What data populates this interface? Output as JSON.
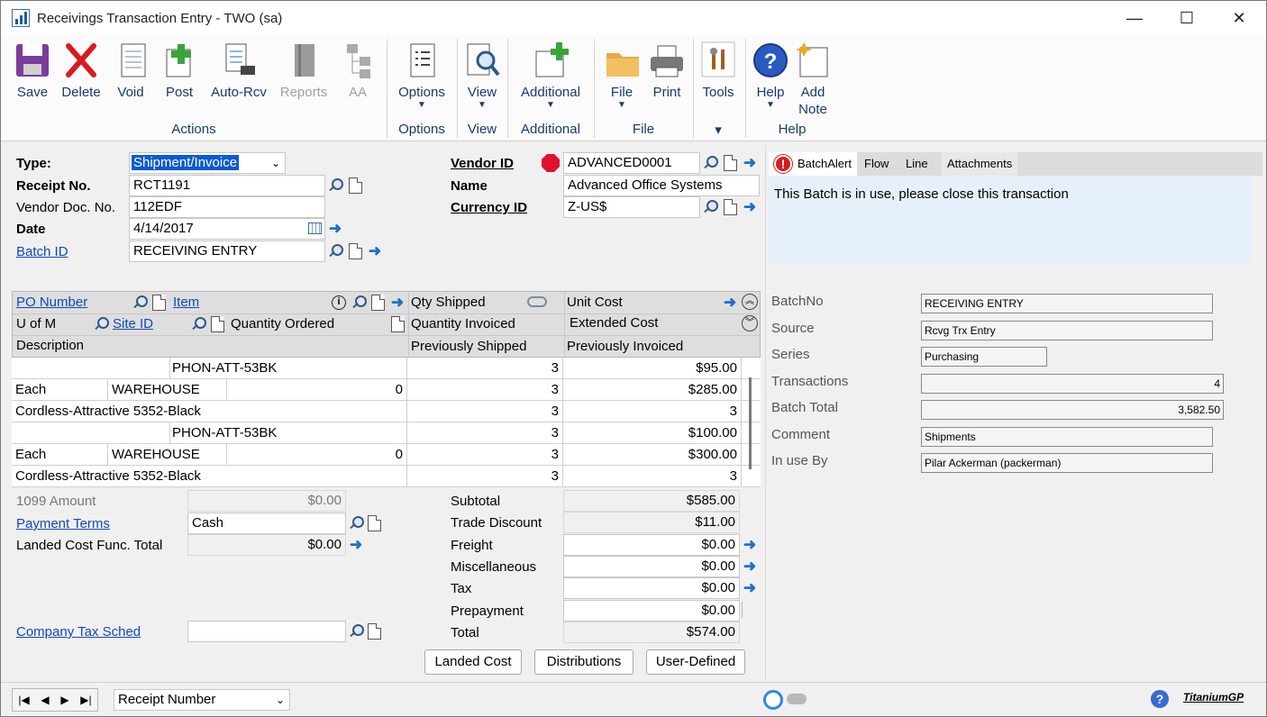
{
  "window": {
    "title": "Receivings Transaction Entry  -  TWO (sa)",
    "minimize": "—",
    "maximize": "☐",
    "close": "✕"
  },
  "ribbon": {
    "buttons": [
      {
        "label": "Save",
        "icon": "save-icon",
        "enabled": true
      },
      {
        "label": "Delete",
        "icon": "delete-icon",
        "enabled": true
      },
      {
        "label": "Void",
        "icon": "void-icon",
        "enabled": true
      },
      {
        "label": "Post",
        "icon": "post-icon",
        "enabled": true
      },
      {
        "label": "Auto-Rcv",
        "icon": "auto-receive-icon",
        "enabled": true
      },
      {
        "label": "Reports",
        "icon": "reports-icon",
        "enabled": false
      },
      {
        "label": "AA",
        "icon": "aa-icon",
        "enabled": false
      },
      {
        "label": "Options",
        "icon": "options-icon",
        "enabled": true
      },
      {
        "label": "View",
        "icon": "view-icon",
        "enabled": true
      },
      {
        "label": "Additional",
        "icon": "additional-icon",
        "enabled": true
      },
      {
        "label": "File",
        "icon": "file-icon",
        "enabled": true
      },
      {
        "label": "Print",
        "icon": "print-icon",
        "enabled": true
      },
      {
        "label": "Tools",
        "icon": "tools-icon",
        "enabled": true
      },
      {
        "label": "Help",
        "icon": "help-icon",
        "enabled": true
      },
      {
        "label": "Add",
        "label2": "Note",
        "icon": "add-note-icon",
        "enabled": true
      }
    ],
    "groups": [
      "Actions",
      "Options",
      "View",
      "Additional",
      "File",
      "Help"
    ],
    "tools_caret": "▾",
    "caret": "▼"
  },
  "header": {
    "type_label": "Type:",
    "type_value": "Shipment/Invoice",
    "receipt_label": "Receipt No.",
    "receipt_value": "RCT1191",
    "vendor_doc_label": "Vendor Doc. No.",
    "vendor_doc_value": "112EDF",
    "date_label": "Date",
    "date_value": "4/14/2017",
    "batch_label": "Batch ID",
    "batch_value": "RECEIVING ENTRY",
    "vendor_id_label": "Vendor ID",
    "vendor_id_value": "ADVANCED0001",
    "name_label": "Name",
    "name_value": "Advanced Office Systems",
    "currency_label": "Currency ID",
    "currency_value": "Z-US$"
  },
  "grid": {
    "hdr1": {
      "po": "PO Number",
      "item": "Item",
      "qty_shipped": "Qty Shipped",
      "unit_cost": "Unit Cost"
    },
    "hdr2": {
      "uofm": "U of M",
      "site": "Site ID",
      "qty_ordered": "Quantity Ordered",
      "qty_invoiced": "Quantity Invoiced",
      "ext_cost": "Extended Cost"
    },
    "hdr3": {
      "desc": "Description",
      "prev_shipped": "Previously Shipped",
      "prev_invoiced": "Previously Invoiced"
    },
    "rows": [
      {
        "c1": "",
        "c2": "PHON-ATT-53BK",
        "c3": "3",
        "c4": "$95.00"
      },
      {
        "c1": "Each",
        "c2": "WAREHOUSE",
        "c2b": "0",
        "c3": "3",
        "c4": "$285.00"
      },
      {
        "c1": "Cordless-Attractive 5352-Black",
        "c3": "3",
        "c4": "3"
      },
      {
        "c1": "",
        "c2": "PHON-ATT-53BK",
        "c3": "3",
        "c4": "$100.00"
      },
      {
        "c1": "Each",
        "c2": "WAREHOUSE",
        "c2b": "0",
        "c3": "3",
        "c4": "$300.00"
      },
      {
        "c1": "Cordless-Attractive 5352-Black",
        "c3": "3",
        "c4": "3"
      }
    ]
  },
  "footer_left": {
    "amount1099_label": "1099 Amount",
    "amount1099_value": "$0.00",
    "payment_terms_label": "Payment Terms",
    "payment_terms_value": "Cash",
    "landed_label": "Landed Cost Func. Total",
    "landed_value": "$0.00",
    "tax_sched_label": "Company Tax Sched",
    "tax_sched_value": ""
  },
  "totals": [
    {
      "label": "Subtotal",
      "value": "$585.00",
      "arrow": false
    },
    {
      "label": "Trade Discount",
      "value": "$11.00",
      "arrow": false
    },
    {
      "label": "Freight",
      "value": "$0.00",
      "arrow": true
    },
    {
      "label": "Miscellaneous",
      "value": "$0.00",
      "arrow": true
    },
    {
      "label": "Tax",
      "value": "$0.00",
      "arrow": true
    },
    {
      "label": "Prepayment",
      "value": "$0.00",
      "arrow": false
    },
    {
      "label": "Total",
      "value": "$574.00",
      "arrow": false
    }
  ],
  "buttons": {
    "landed_cost": "Landed Cost",
    "distributions": "Distributions",
    "user_defined": "User-Defined"
  },
  "pane": {
    "tabs": [
      "BatchAlert",
      "Flow",
      "Line",
      "Attachments"
    ],
    "message": "This Batch is in use, please close this transaction",
    "fields": [
      {
        "label": "BatchNo",
        "value": "RECEIVING ENTRY"
      },
      {
        "label": "Source",
        "value": "Rcvg Trx Entry"
      },
      {
        "label": "Series",
        "value": "Purchasing"
      },
      {
        "label": "Transactions",
        "value": "4"
      },
      {
        "label": "Batch Total",
        "value": "3,582.50"
      },
      {
        "label": "Comment",
        "value": "Shipments"
      },
      {
        "label": "In use By",
        "value": "Pilar Ackerman (packerman)"
      }
    ]
  },
  "status": {
    "sort_value": "Receipt Number",
    "brand": "TitaniumGP",
    "nav": [
      "|◀",
      "◀",
      "▶",
      "▶|"
    ]
  },
  "colors": {
    "accent": "#1048b8",
    "ribbon_text": "#1a3a6a",
    "alert_bg": "#e5f0fa",
    "stop": "#e01030"
  }
}
